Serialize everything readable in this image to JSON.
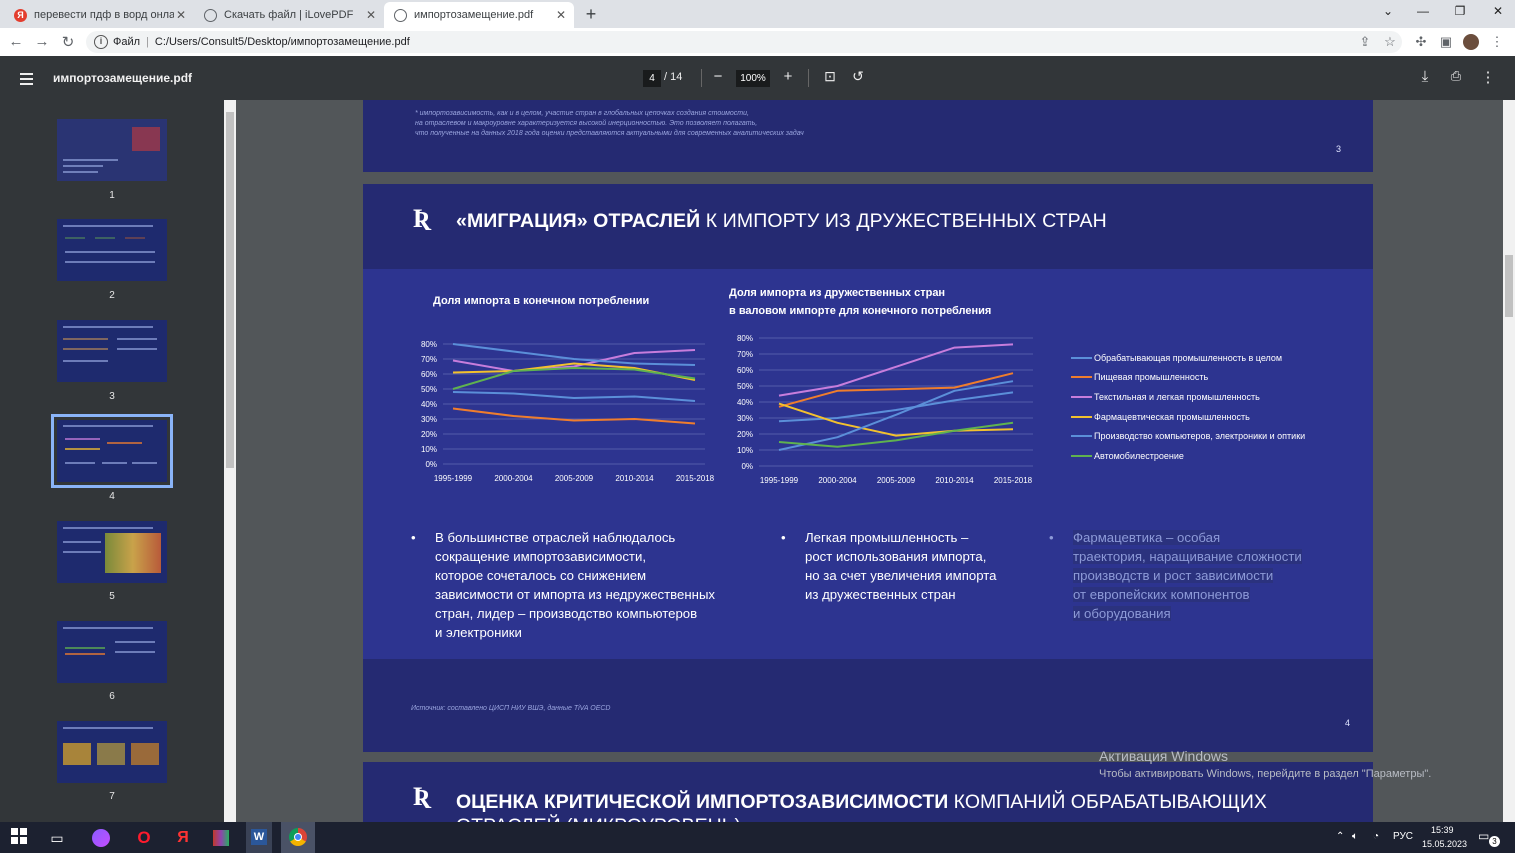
{
  "browser": {
    "tabs": [
      {
        "title": "перевести пдф в ворд онлайн б",
        "favicon": "yandex-icon",
        "color": "#e33d2e"
      },
      {
        "title": "Скачать файл | iLovePDF",
        "favicon": "globe-icon",
        "color": "#5f6368"
      },
      {
        "title": "импортозамещение.pdf",
        "favicon": "globe-icon",
        "color": "#5f6368"
      }
    ],
    "new_tab": "+",
    "address": {
      "scheme_label": "Файл",
      "separator": "|",
      "url": "C:/Users/Consult5/Desktop/импортозамещение.pdf"
    }
  },
  "viewer": {
    "title": "импортозамещение.pdf",
    "page_current": "4",
    "page_total": "/ 14",
    "zoom": "100%",
    "minus": "−",
    "plus": "+"
  },
  "thumbnails": [
    "1",
    "2",
    "3",
    "4",
    "5",
    "6",
    "7"
  ],
  "page3": {
    "footnote": [
      "* импортозависимость, как и в целом, участие стран в глобальных цепочках создания стоимости,",
      "на отраслевом и макроуровне характеризуется высокой инерционностью. Это позволяет полагать,",
      "что полученные на данных 2018 года оценки представляются актуальными для современных аналитических задач"
    ],
    "number": "3"
  },
  "page4": {
    "logo": "Ʀ",
    "title_bold": "«МИГРАЦИЯ» ОТРАСЛЕЙ",
    "title_rest": " К ИМПОРТУ ИЗ ДРУЖЕСТВЕННЫХ СТРАН",
    "bullets": [
      {
        "lines": [
          "В большинстве отраслей наблюдалось",
          "сокращение импортозависимости,",
          "которое сочеталось со снижением",
          "зависимости от импорта из недружественных",
          "стран, лидер – производство компьютеров",
          "и электроники"
        ]
      },
      {
        "lines": [
          "Легкая промышленность –",
          "рост использования импорта,",
          "но за счет увеличения импорта",
          "из дружественных стран"
        ]
      },
      {
        "lines": [
          "Фармацевтика – особая",
          "траектория, наращивание сложности",
          "производств и рост зависимости",
          "от европейских компонентов",
          "и оборудования"
        ]
      }
    ],
    "bullet_char": "•",
    "source": "Источник: составлено ЦИСП НИУ ВШЭ, данные TiVA OECD",
    "number": "4"
  },
  "page5": {
    "logo": "Ʀ",
    "title_bold": "ОЦЕНКА КРИТИЧЕСКОЙ ИМПОРТОЗАВИСИМОСТИ",
    "title_rest": " КОМПАНИЙ ОБРАБАТЫВАЮЩИХ",
    "title_line2": "ОТРАСЛЕЙ (МИКРОУРОВЕНЬ)"
  },
  "watermark": {
    "title": "Активация Windows",
    "text": "Чтобы активировать Windows, перейдите в раздел \"Параметры\"."
  },
  "taskbar": {
    "lang": "РУС",
    "time": "15:39",
    "date": "15.05.2023",
    "notif": "3"
  },
  "chart_data": [
    {
      "type": "line",
      "title": "Доля импорта в конечном потреблении",
      "categories": [
        "1995-1999",
        "2000-2004",
        "2005-2009",
        "2010-2014",
        "2015-2018"
      ],
      "ylim": [
        0,
        80
      ],
      "ytick_labels": [
        "0%",
        "10%",
        "20%",
        "30%",
        "40%",
        "50%",
        "60%",
        "70%",
        "80%"
      ],
      "grid": true,
      "series": [
        {
          "name": "Обрабатывающая промышленность в целом",
          "color": "#5b8fd9",
          "values": [
            48,
            47,
            44,
            45,
            42
          ]
        },
        {
          "name": "Пищевая промышленность",
          "color": "#ef7d2d",
          "values": [
            37,
            32,
            29,
            30,
            27
          ]
        },
        {
          "name": "Текстильная и легкая промышленность",
          "color": "#c77ddc",
          "values": [
            69,
            62,
            65,
            74,
            76
          ]
        },
        {
          "name": "Фармацевтическая промышленность",
          "color": "#f2c12e",
          "values": [
            61,
            62,
            67,
            64,
            56
          ]
        },
        {
          "name": "Производство компьютеров, электроники и оптики",
          "color": "#5b8fd9",
          "values": [
            80,
            75,
            70,
            67,
            66
          ]
        },
        {
          "name": "Автомобилестроение",
          "color": "#5fb24f",
          "values": [
            50,
            62,
            64,
            63,
            57
          ]
        }
      ]
    },
    {
      "type": "line",
      "title": "Доля импорта из дружественных стран в валовом импорте для конечного потребления",
      "title_lines": [
        "Доля импорта из дружественных стран",
        "в валовом импорте для конечного потребления"
      ],
      "categories": [
        "1995-1999",
        "2000-2004",
        "2005-2009",
        "2010-2014",
        "2015-2018"
      ],
      "ylim": [
        0,
        80
      ],
      "ytick_labels": [
        "0%",
        "10%",
        "20%",
        "30%",
        "40%",
        "50%",
        "60%",
        "70%",
        "80%"
      ],
      "grid": true,
      "legend": "right",
      "series": [
        {
          "name": "Обрабатывающая промышленность в целом",
          "color": "#5b8fd9",
          "values": [
            28,
            30,
            35,
            41,
            46
          ]
        },
        {
          "name": "Пищевая промышленность",
          "color": "#ef7d2d",
          "values": [
            37,
            47,
            48,
            49,
            58
          ]
        },
        {
          "name": "Текстильная и легкая промышленность",
          "color": "#c77ddc",
          "values": [
            44,
            50,
            62,
            74,
            76
          ]
        },
        {
          "name": "Фармацевтическая промышленность",
          "color": "#f2c12e",
          "values": [
            39,
            27,
            19,
            22,
            23
          ]
        },
        {
          "name": "Производство компьютеров, электроники и оптики",
          "color": "#5b8fd9",
          "values": [
            10,
            18,
            32,
            47,
            53
          ]
        },
        {
          "name": "Автомобилестроение",
          "color": "#5fb24f",
          "values": [
            15,
            12,
            16,
            22,
            27
          ]
        }
      ]
    }
  ]
}
